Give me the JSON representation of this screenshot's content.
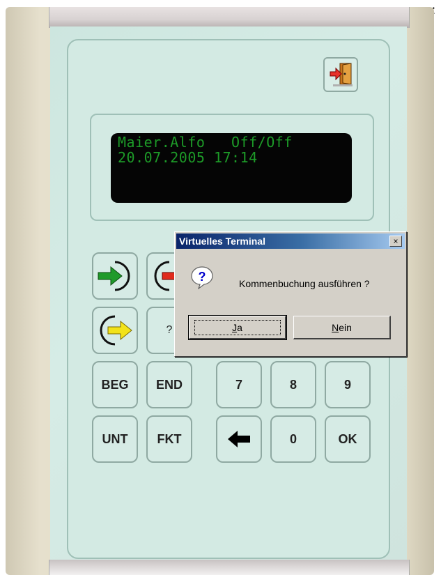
{
  "window": {
    "minimize_label": "-",
    "close_label": "×"
  },
  "terminal": {
    "lcd": {
      "line1": "Maier.Alfo   Off/Off",
      "line2": "20.07.2005 17:14"
    },
    "exit_icon": "door-exit-icon",
    "keys": {
      "come": {
        "icon": "arrow-in-green-icon"
      },
      "go": {
        "icon": "arrow-out-red-icon"
      },
      "come_back": {
        "icon": "arrow-in-yellow-icon"
      },
      "help": {
        "label": "?"
      },
      "beg": {
        "label": "BEG"
      },
      "end": {
        "label": "END"
      },
      "unt": {
        "label": "UNT"
      },
      "fkt": {
        "label": "FKT"
      },
      "seven": {
        "label": "7"
      },
      "eight": {
        "label": "8"
      },
      "nine": {
        "label": "9"
      },
      "zero": {
        "label": "0"
      },
      "ok": {
        "label": "OK"
      },
      "backspace": {
        "icon": "arrow-left-icon"
      }
    }
  },
  "dialog": {
    "title": "Virtuelles Terminal",
    "close_label": "×",
    "icon": "question-icon",
    "message": "Kommenbuchung ausführen ?",
    "yes_label_first": "J",
    "yes_label_rest": "a",
    "no_label_first": "N",
    "no_label_rest": "ein"
  },
  "colors": {
    "lcd_text": "#1d9b28",
    "titlebar_start": "#0a246a",
    "titlebar_end": "#a6caf0",
    "arrow_green": "#1f9a2a",
    "arrow_red": "#e02a1c",
    "arrow_yellow": "#f2e21a"
  }
}
